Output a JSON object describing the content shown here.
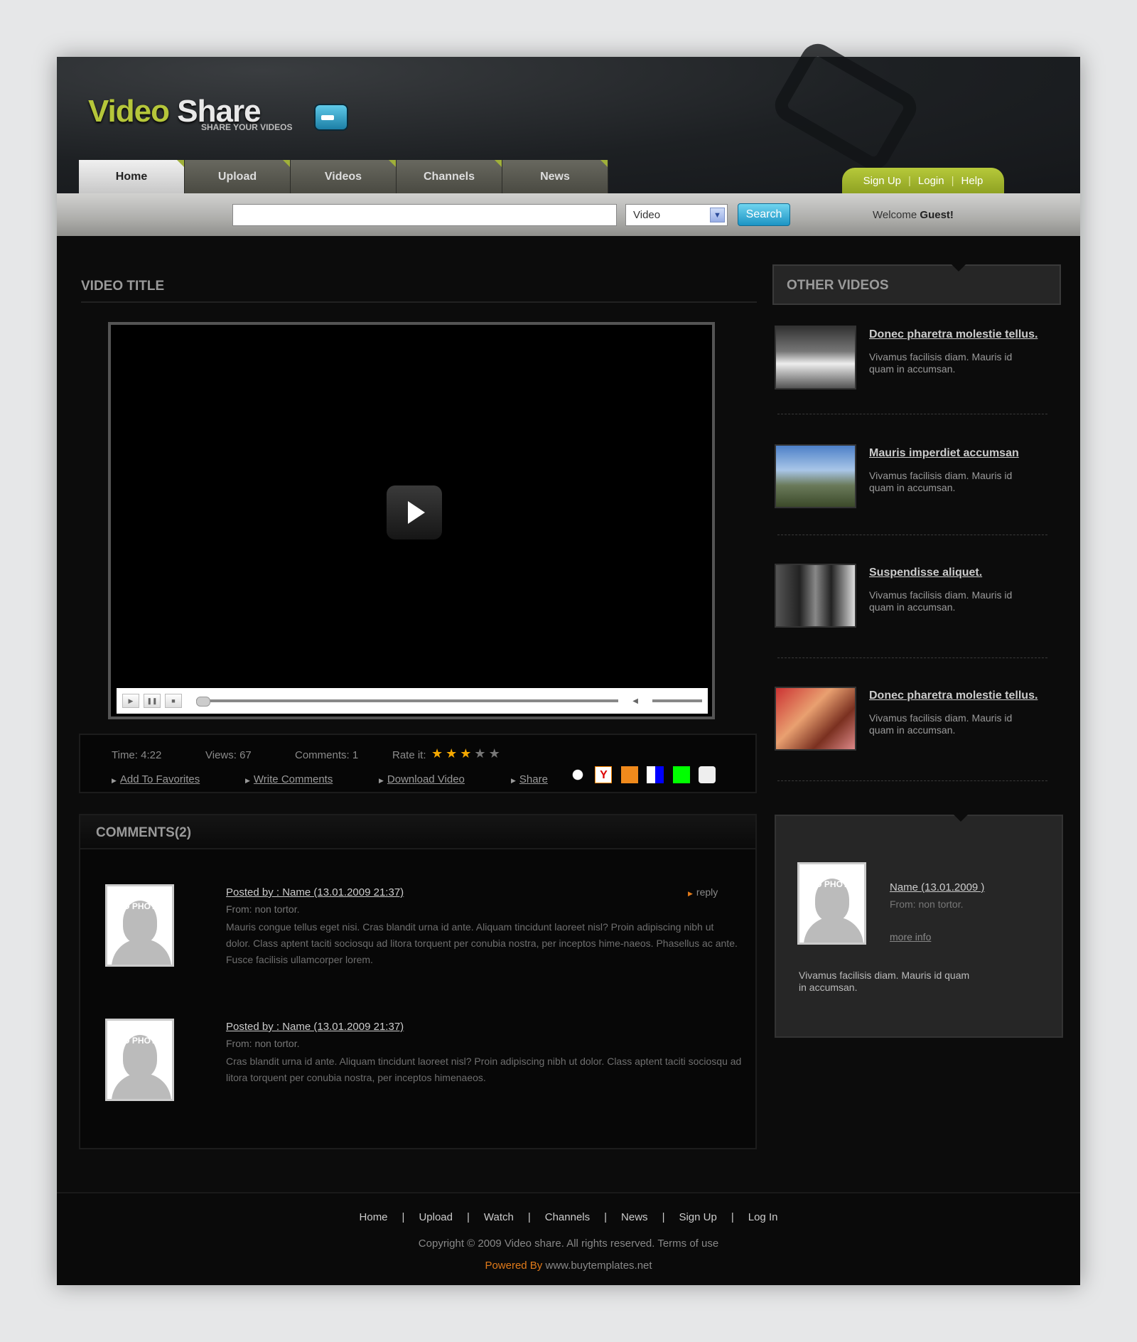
{
  "logo": {
    "word1": "Video",
    "word2": "Share",
    "tagline": "SHARE YOUR VIDEOS"
  },
  "nav": {
    "tabs": [
      {
        "label": "Home",
        "active": true
      },
      {
        "label": "Upload"
      },
      {
        "label": "Videos"
      },
      {
        "label": "Channels"
      },
      {
        "label": "News"
      }
    ]
  },
  "user_links": [
    "Sign Up",
    "Login",
    "Help"
  ],
  "search": {
    "value": "",
    "placeholder": "",
    "category": "Video",
    "button": "Search"
  },
  "welcome": {
    "prefix": "Welcome",
    "name": "Guest!"
  },
  "video": {
    "title": "VIDEO TITLE"
  },
  "video_info": {
    "time": "Time: 4:22",
    "views": "Views: 67",
    "comments": "Comments: 1",
    "rate_label": "Rate it:",
    "rating": 3,
    "max_rating": 5,
    "actions": [
      "Add To Favorites",
      "Write Comments",
      "Download Video",
      "Share"
    ],
    "share_icons": [
      "delicious-icon",
      "yahoo-icon",
      "blogmarks-icon",
      "delicious-square-icon",
      "green-square-icon",
      "reddit-icon"
    ]
  },
  "comments": {
    "heading": "COMMENTS(2)",
    "reply": "reply",
    "no_photo": "NO PHOTO",
    "items": [
      {
        "posted": "Posted by : Name (13.01.2009 21:37)",
        "from": "From: non tortor.",
        "text": "Mauris congue tellus eget nisi. Cras blandit urna id ante. Aliquam tincidunt laoreet nisl? Proin adipiscing nibh ut dolor. Class aptent taciti sociosqu ad litora torquent per conubia nostra, per inceptos hime-naeos. Phasellus ac ante. Fusce facilisis ullamcorper lorem."
      },
      {
        "posted": "Posted by : Name (13.01.2009 21:37)",
        "from": "From: non tortor.",
        "text": "Cras blandit urna id ante. Aliquam tincidunt laoreet nisl? Proin adipiscing nibh ut dolor. Class aptent taciti sociosqu ad litora torquent per conubia nostra, per inceptos himenaeos."
      }
    ]
  },
  "other_videos": {
    "heading": "OTHER VIDEOS",
    "items": [
      {
        "title": "Donec pharetra molestie tellus.",
        "desc": "Vivamus facilisis diam. Mauris id quam in accumsan."
      },
      {
        "title": "Mauris imperdiet accumsan",
        "desc": "Vivamus facilisis diam. Mauris id quam in accumsan."
      },
      {
        "title": "Suspendisse aliquet.",
        "desc": "Vivamus facilisis diam. Mauris id quam in accumsan."
      },
      {
        "title": "Donec pharetra molestie tellus.",
        "desc": "Vivamus facilisis diam. Mauris id quam in accumsan."
      }
    ]
  },
  "profile": {
    "name": "Name (13.01.2009 )",
    "from": "From: non tortor.",
    "more": "more info",
    "text": "Vivamus facilisis diam. Mauris id quam in accumsan."
  },
  "footer": {
    "links": [
      "Home",
      "Upload",
      "Watch",
      "Channels",
      "News",
      "Sign Up",
      "Log In"
    ],
    "copyright": "Copyright © 2009 Video share. All rights reserved. Terms of use",
    "powered_label": "Powered By",
    "powered_site": "www.buytemplates.net"
  },
  "colors": {
    "accent_green": "#b5c63a",
    "search_blue": "#1c94c4",
    "star": "#f5a800",
    "powered": "#e07a1a"
  }
}
